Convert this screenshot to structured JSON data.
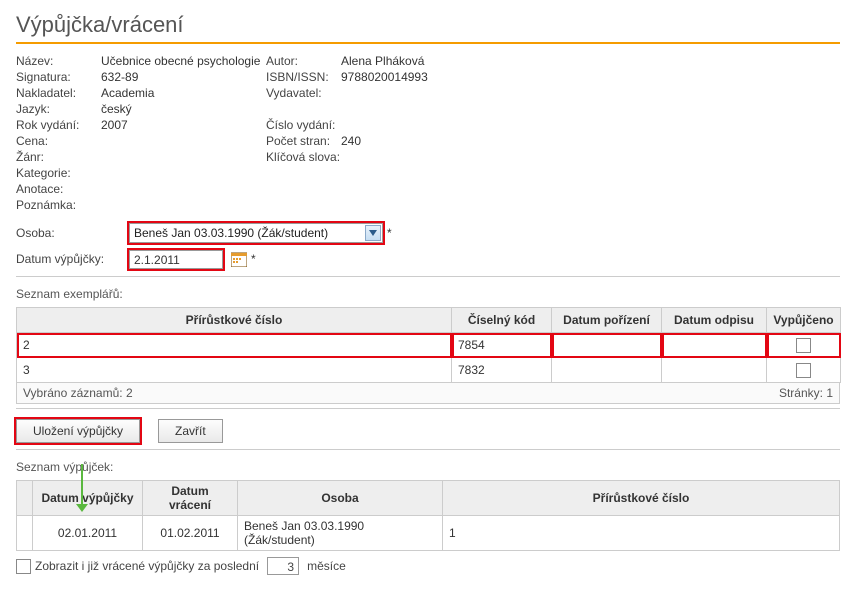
{
  "title": "Výpůjčka/vrácení",
  "meta": {
    "labels": {
      "name": "Název:",
      "sig": "Signatura:",
      "pub": "Nakladatel:",
      "lang": "Jazyk:",
      "year": "Rok vydání:",
      "price": "Cena:",
      "genre": "Žánr:",
      "cat": "Kategorie:",
      "annot": "Anotace:",
      "note": "Poznámka:",
      "author": "Autor:",
      "isbn": "ISBN/ISSN:",
      "pub2": "Vydavatel:",
      "ed": "Číslo vydání:",
      "pages": "Počet stran:",
      "kw": "Klíčová slova:"
    },
    "values": {
      "name": "Učebnice obecné psychologie",
      "sig": "632-89",
      "pub": "Academia",
      "lang": "český",
      "year": "2007",
      "price": "",
      "genre": "",
      "author": "Alena Plháková",
      "isbn": "9788020014993",
      "pub2": "",
      "ed": "",
      "pages": "240",
      "kw": ""
    }
  },
  "form": {
    "personLabel": "Osoba:",
    "personValue": "Beneš Jan 03.03.1990 (Žák/student)",
    "dateLabel": "Datum výpůjčky:",
    "dateValue": "2.1.2011"
  },
  "copies": {
    "sectionLabel": "Seznam exemplářů:",
    "headers": [
      "Přírůstkové číslo",
      "Číselný kód",
      "Datum pořízení",
      "Datum odpisu",
      "Vypůjčeno"
    ],
    "rows": [
      {
        "acc": "2",
        "code": "7854",
        "dp": "",
        "do": "",
        "chk": false,
        "hl": true
      },
      {
        "acc": "3",
        "code": "7832",
        "dp": "",
        "do": "",
        "chk": false,
        "hl": false
      }
    ],
    "statusLeft": "Vybráno záznamů: 2",
    "statusRight": "Stránky: 1"
  },
  "buttons": {
    "save": "Uložení výpůjčky",
    "close": "Zavřít"
  },
  "loans": {
    "sectionLabel": "Seznam výpůjček:",
    "headers": [
      "Datum výpůjčky",
      "Datum vrácení",
      "Osoba",
      "Přírůstkové číslo"
    ],
    "rows": [
      {
        "d1": "02.01.2011",
        "d2": "01.02.2011",
        "os": "Beneš Jan 03.03.1990 (Žák/student)",
        "acc": "1"
      }
    ],
    "showLabelBefore": "Zobrazit i již vrácené výpůjčky za poslední",
    "months": "3",
    "showLabelAfter": "měsíce"
  }
}
